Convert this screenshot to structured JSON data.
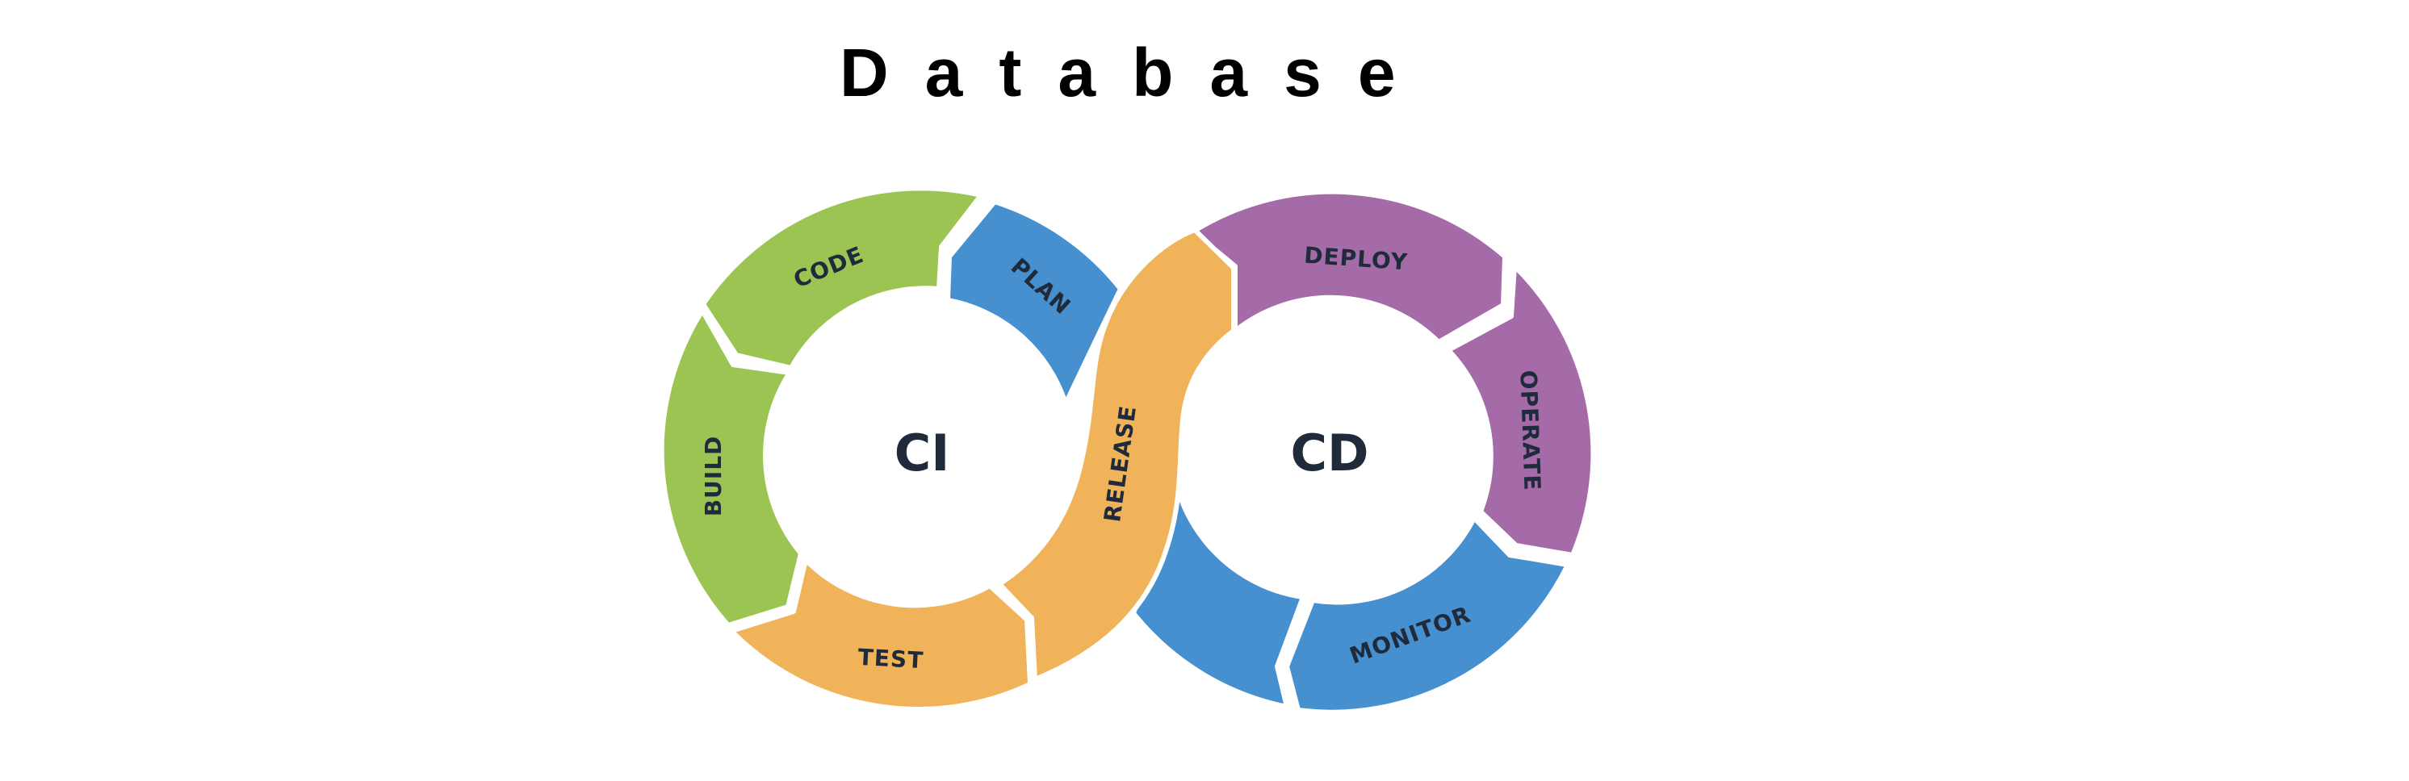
{
  "title": "Database",
  "diagram": {
    "hubs": {
      "ci": "CI",
      "cd": "CD"
    },
    "stages": {
      "plan": "PLAN",
      "code": "CODE",
      "build": "BUILD",
      "test": "TEST",
      "release": "RELEASE",
      "deploy": "DEPLOY",
      "operate": "OPERATE",
      "monitor": "MONITOR"
    },
    "colors": {
      "plan": "#4690d0",
      "code": "#9cc453",
      "build": "#9cc453",
      "test": "#f0b35a",
      "release": "#f0b35a",
      "deploy": "#a46ba8",
      "operate": "#a46ba8",
      "monitor": "#4690d0",
      "text": "#1f2a3a",
      "background": "#ffffff"
    }
  }
}
